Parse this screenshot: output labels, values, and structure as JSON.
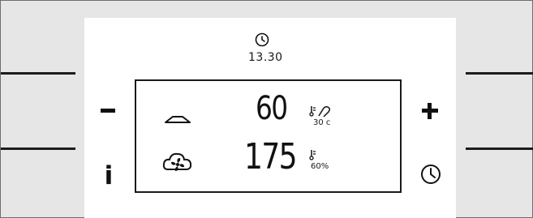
{
  "display": {
    "time": "13.30",
    "top_value": "60",
    "top_unit": "30 c",
    "bottom_value": "175",
    "bottom_unit": "60%"
  },
  "buttons": {
    "minus": "minus",
    "plus": "plus",
    "info": "i",
    "clock": "clock"
  },
  "icons": {
    "top_clock": "clock-icon",
    "dome": "dome-icon",
    "cloud": "cloud-fan-icon",
    "temp_probe": "temperature-probe-icon",
    "humidity": "humidity-icon"
  },
  "colors": {
    "panel": "#e6e6e6",
    "face": "#ffffff",
    "ink": "#111111"
  }
}
